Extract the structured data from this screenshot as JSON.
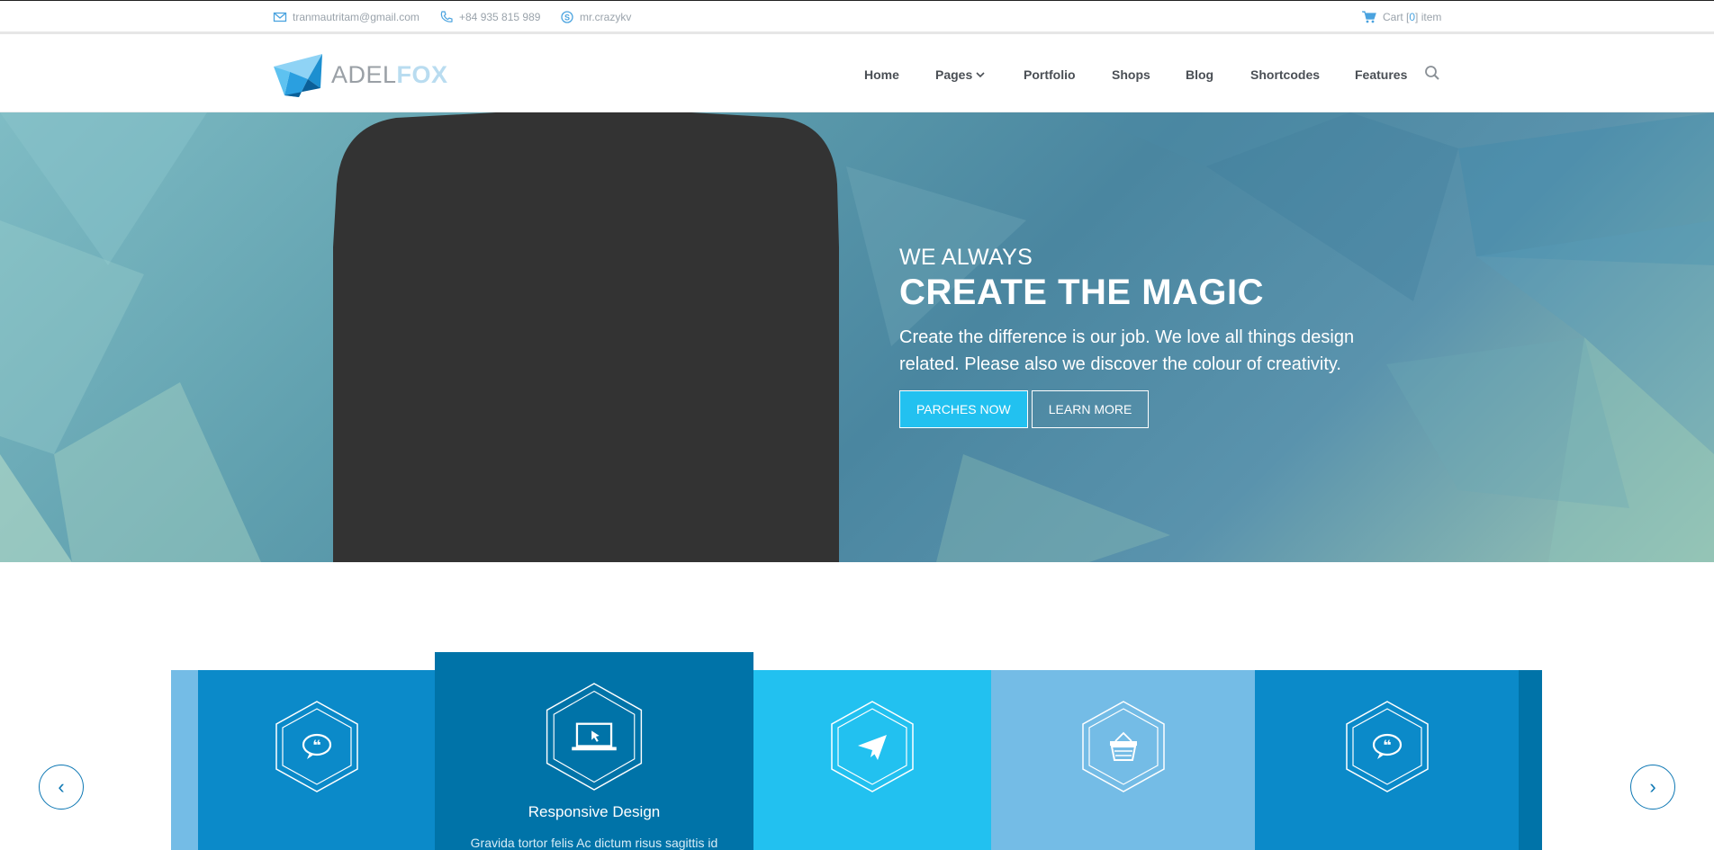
{
  "topbar": {
    "email": "tranmautritam@gmail.com",
    "phone": "+84 935 815 989",
    "skype": "mr.crazykv",
    "cart_label": "Cart [",
    "cart_count": "0",
    "cart_suffix": "] item"
  },
  "header": {
    "logo_light": "ADEL",
    "logo_bold": "FOX",
    "nav": [
      "Home",
      "Pages",
      "Portfolio",
      "Shops",
      "Blog",
      "Shortcodes",
      "Features"
    ]
  },
  "hero": {
    "kicker": "WE ALWAYS",
    "title": "CREATE THE MAGIC",
    "description": "Create the difference is our job. We love all things design related. Please also we discover the colour of creativity.",
    "primary_button": "PARCHES NOW",
    "secondary_button": "LEARN MORE"
  },
  "features": {
    "items": [
      {
        "icon": "quote-bubble-icon",
        "title": "",
        "description": ""
      },
      {
        "icon": "laptop-icon",
        "title": "Responsive Design",
        "description": "Gravida tortor felis Ac dictum risus sagittis id"
      },
      {
        "icon": "paper-plane-icon",
        "title": "",
        "description": ""
      },
      {
        "icon": "shopping-basket-icon",
        "title": "",
        "description": ""
      },
      {
        "icon": "quote-bubble-icon",
        "title": "",
        "description": ""
      }
    ],
    "prev_label": "‹",
    "next_label": "›"
  },
  "colors": {
    "accent": "#22c1f0",
    "feature_blue": "#0b8ac9",
    "feature_dark": "#0073a8",
    "feature_light": "#74bce6",
    "phone": "#333333"
  }
}
